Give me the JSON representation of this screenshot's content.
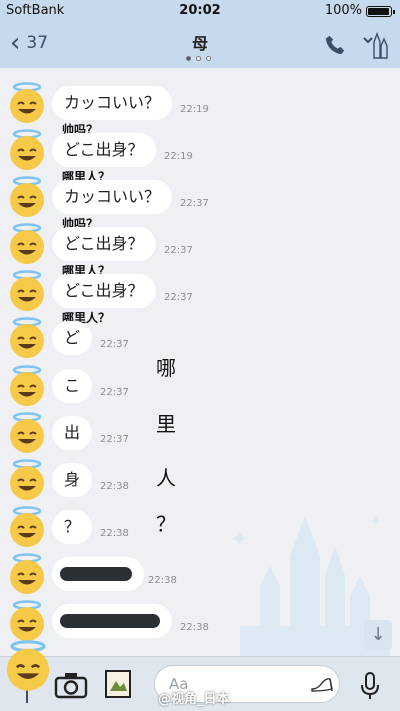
{
  "status": {
    "carrier": "SoftBank",
    "time": "20:02",
    "battery": "100%"
  },
  "header": {
    "back_count": "37",
    "title": "母"
  },
  "messages": [
    {
      "text": "カッコいい？",
      "time": "22:19",
      "caption": "帅吗？"
    },
    {
      "text": "どこ出身？",
      "time": "22:19",
      "caption": "哪里人？"
    },
    {
      "text": "カッコいい？",
      "time": "22:37",
      "caption": "帅吗？"
    },
    {
      "text": "どこ出身？",
      "time": "22:37",
      "caption": "哪里人？"
    },
    {
      "text": "どこ出身？",
      "time": "22:37",
      "caption": "哪里人？"
    },
    {
      "text": "ど",
      "time": "22:37"
    },
    {
      "text": "こ",
      "time": "22:37"
    },
    {
      "text": "出",
      "time": "22:37"
    },
    {
      "text": "身",
      "time": "22:38"
    },
    {
      "text": "？",
      "time": "22:38"
    },
    {
      "text": "",
      "time": "22:38"
    },
    {
      "text": "",
      "time": "22:38"
    }
  ],
  "vertical_note": [
    "哪",
    "里",
    "人",
    "？"
  ],
  "input": {
    "placeholder": "Aa"
  },
  "watermark": "@视角_日本",
  "colors": {
    "header": "#c7d9ec",
    "bubble": "#ffffff",
    "background": "#eef0f3"
  }
}
